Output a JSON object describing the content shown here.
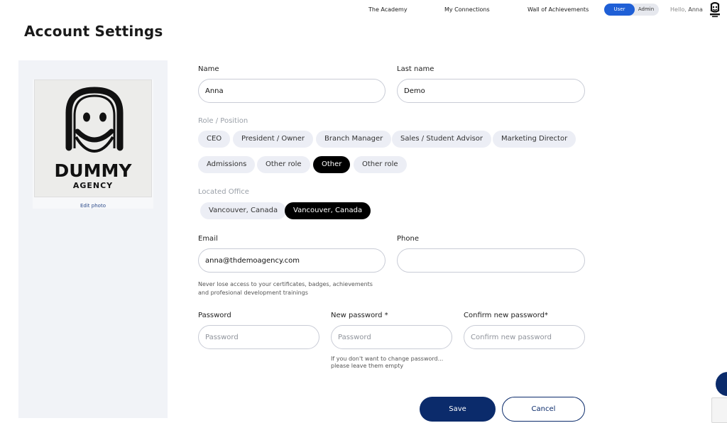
{
  "nav": {
    "links": [
      "The Academy",
      "My Connections",
      "Wall of Achievements"
    ],
    "toggle": {
      "user": "User",
      "admin": "Admin"
    },
    "hello": "Hello,",
    "user_name": "Anna"
  },
  "page_title": "Account Settings",
  "profile": {
    "logo_line1": "DUMMY",
    "logo_line2": "AGENCY",
    "edit_photo": "Edit photo"
  },
  "form": {
    "name_label": "Name",
    "name_value": "Anna",
    "last_name_label": "Last name",
    "last_name_value": "Demo",
    "role_label": "Role / Position",
    "roles": [
      "CEO",
      "President / Owner",
      "Branch Manager",
      "Sales / Student Advisor",
      "Marketing Director",
      "Admissions",
      "Other role",
      "Other",
      "Other role"
    ],
    "office_label": "Located Office",
    "offices": [
      "Vancouver, Canada",
      "Vancouver, Canada"
    ],
    "email_label": "Email",
    "email_value": "anna@thdemoagency.com",
    "email_hint": "Never lose access to your certificates, badges, achievements and profesional development trainings",
    "phone_label": "Phone",
    "phone_value": "",
    "password_label": "Password",
    "password_placeholder": "Password",
    "new_password_label": "New password *",
    "new_password_placeholder": "Password",
    "confirm_password_label": "Confirm new password*",
    "confirm_password_placeholder": "Confirm new password",
    "password_hint_line1": "If you don't want to change password...",
    "password_hint_line2": "please leave them empty"
  },
  "actions": {
    "save": "Save",
    "cancel": "Cancel"
  },
  "colors": {
    "primary": "#0b2b6b",
    "toggle_active": "#1f5fd6",
    "chip_bg": "#eceef5",
    "chip_active": "#000000",
    "panel_bg": "#f1f3f7"
  }
}
